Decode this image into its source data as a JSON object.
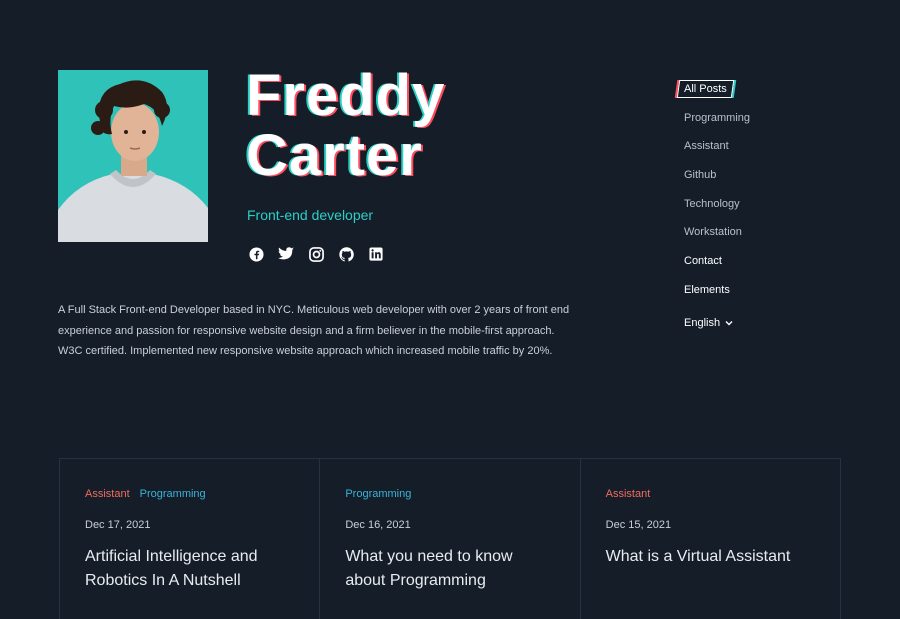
{
  "profile": {
    "first_name": "Freddy",
    "last_name": "Carter",
    "role": "Front-end developer",
    "bio": "A Full Stack Front-end Developer based in NYC. Meticulous web developer with over 2 years of front end experience and passion for responsive website design and a firm believer in the mobile-first approach. W3C certified. Implemented new responsive website approach which increased mobile traffic by 20%.",
    "socials": [
      "facebook-icon",
      "twitter-icon",
      "instagram-icon",
      "github-icon",
      "linkedin-icon"
    ]
  },
  "nav": {
    "active": "All Posts",
    "items": [
      "Programming",
      "Assistant",
      "Github",
      "Technology",
      "Workstation"
    ],
    "contact": "Contact",
    "elements": "Elements",
    "language": "English"
  },
  "posts": [
    {
      "tags": [
        "Assistant",
        "Programming"
      ],
      "date": "Dec 17, 2021",
      "title": "Artificial Intelligence and Robotics In A Nutshell"
    },
    {
      "tags": [
        "Programming"
      ],
      "date": "Dec 16, 2021",
      "title": "What you need to know about Programming"
    },
    {
      "tags": [
        "Assistant"
      ],
      "date": "Dec 15, 2021",
      "title": "What is a Virtual Assistant"
    }
  ],
  "colors": {
    "background": "#151d28",
    "accent_teal": "#2ad0c6",
    "accent_red": "#ff4d5e",
    "tag_assistant": "#f06c5f",
    "tag_programming": "#3ab2d9"
  }
}
